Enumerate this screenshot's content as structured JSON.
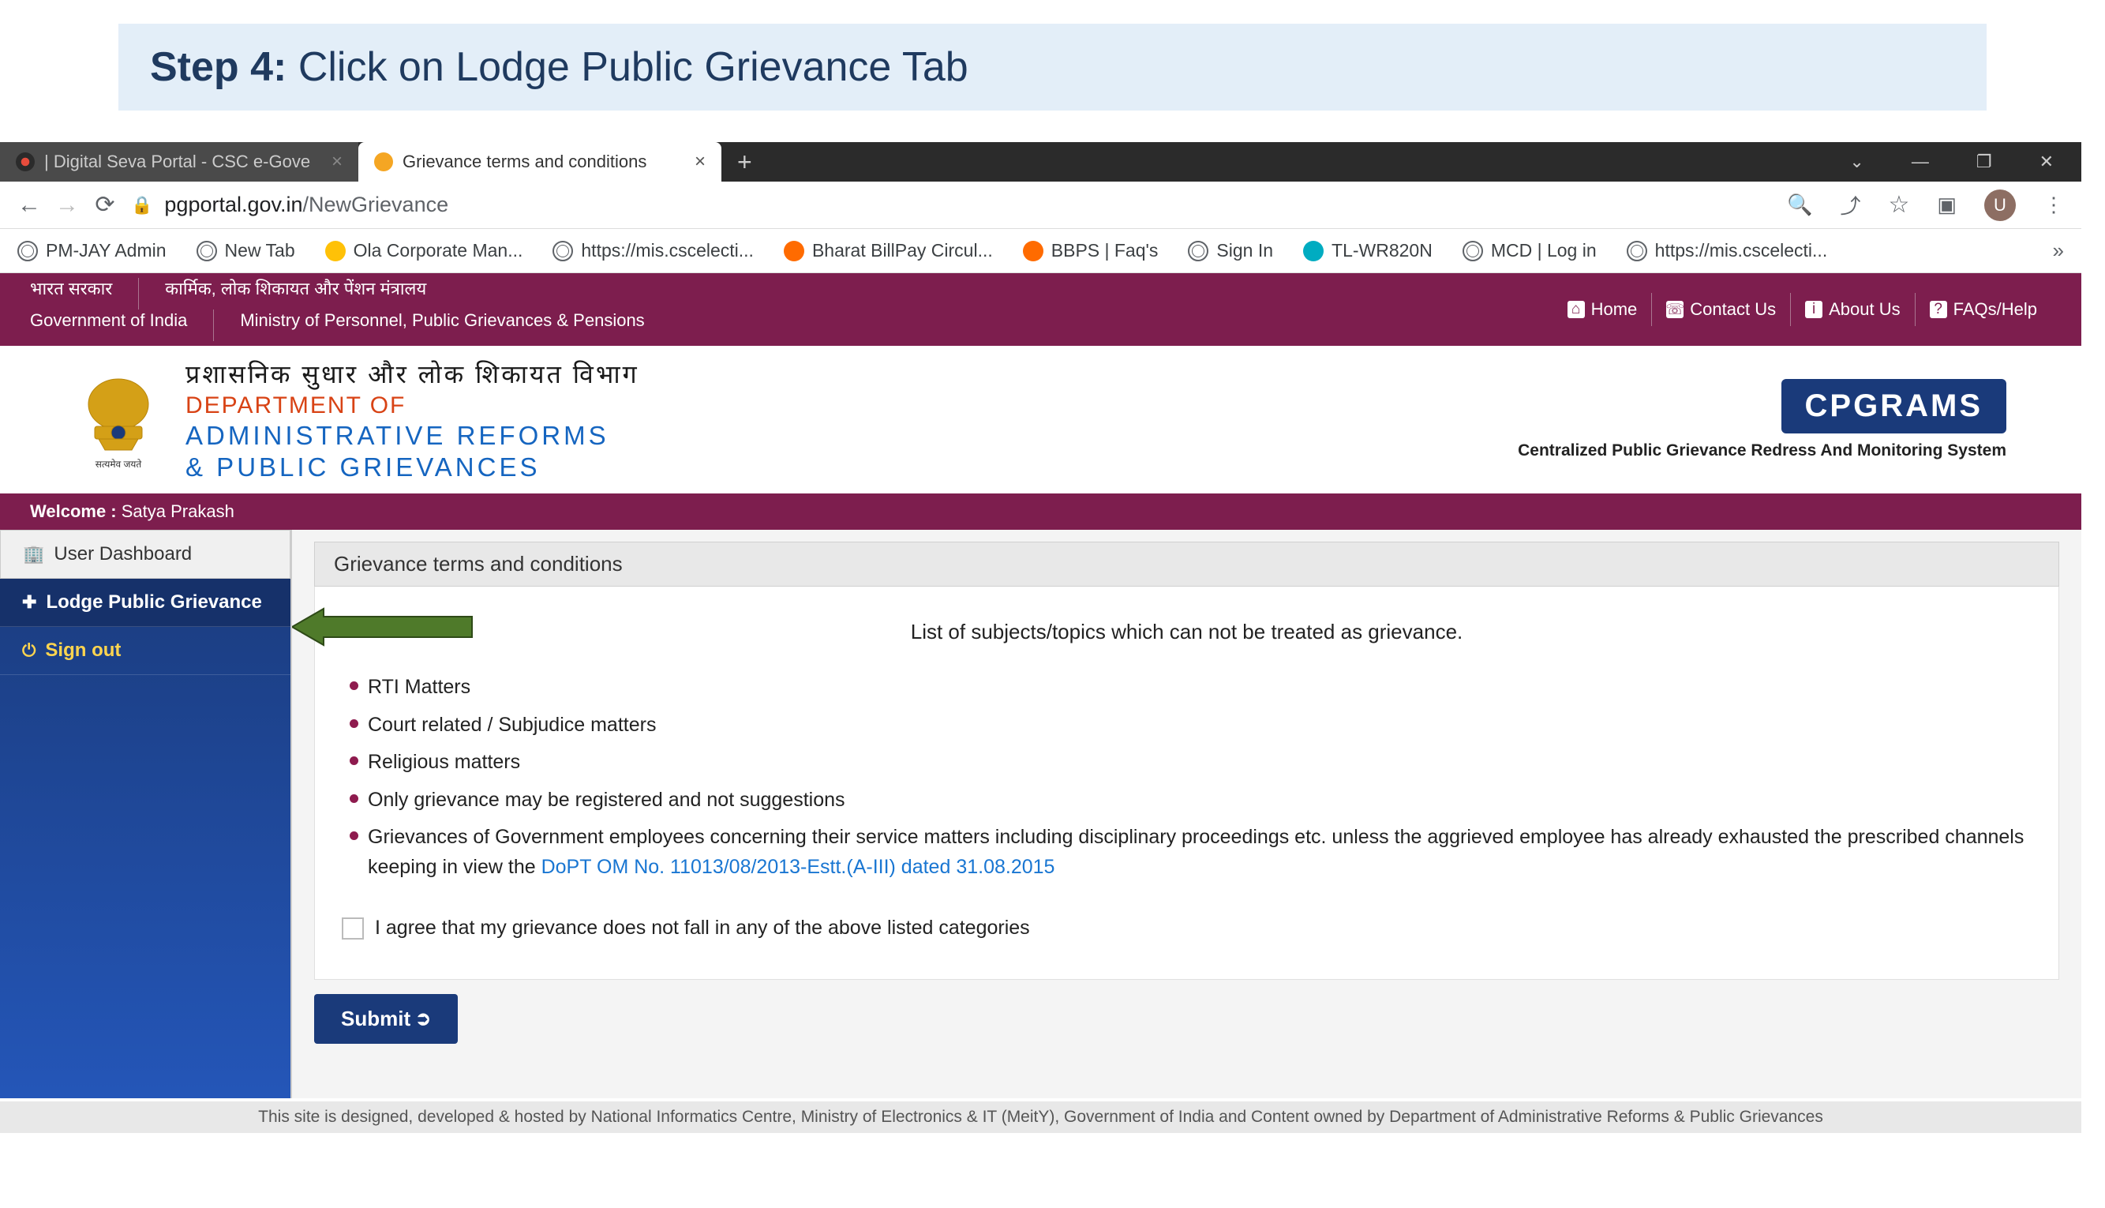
{
  "stepBanner": {
    "prefix": "Step 4:",
    "text": " Click on Lodge Public Grievance Tab"
  },
  "tabs": {
    "inactive": {
      "title": "| Digital Seva Portal - CSC e-Gove"
    },
    "active": {
      "title": "Grievance terms and conditions"
    }
  },
  "url": {
    "domain": "pgportal.gov.in",
    "path": "/NewGrievance"
  },
  "profileInitial": "U",
  "bookmarks": [
    {
      "label": "PM-JAY Admin",
      "icon": "globe"
    },
    {
      "label": "New Tab",
      "icon": "globe"
    },
    {
      "label": "Ola Corporate Man...",
      "icon": "yellow"
    },
    {
      "label": "https://mis.cscelecti...",
      "icon": "globe"
    },
    {
      "label": "Bharat BillPay Circul...",
      "icon": "orange"
    },
    {
      "label": "BBPS | Faq's",
      "icon": "orange-b"
    },
    {
      "label": "Sign In",
      "icon": "globe"
    },
    {
      "label": "TL-WR820N",
      "icon": "teal"
    },
    {
      "label": "MCD | Log in",
      "icon": "globe"
    },
    {
      "label": "https://mis.cscelecti...",
      "icon": "globe"
    }
  ],
  "govTop": {
    "leftHindi1": "भारत सरकार",
    "leftHindi2": "कार्मिक, लोक शिकायत और पेंशन मंत्रालय",
    "leftEng1": "Government of India",
    "leftEng2": "Ministry of Personnel, Public Grievances & Pensions",
    "links": [
      "Home",
      "Contact Us",
      "About Us",
      "FAQs/Help"
    ]
  },
  "dept": {
    "hindi": "प्रशासनिक सुधार और लोक शिकायत विभाग",
    "line1": "DEPARTMENT OF",
    "line2": "ADMINISTRATIVE REFORMS",
    "line3": "& PUBLIC GRIEVANCES",
    "cpgramsBadge": "CPGRAMS",
    "cpgramsSub": "Centralized Public Grievance Redress And Monitoring System"
  },
  "welcome": {
    "label": "Welcome : ",
    "name": "Satya Prakash"
  },
  "sidebar": {
    "dashboard": "User Dashboard",
    "lodge": "Lodge Public Grievance",
    "signout": "Sign out"
  },
  "panel": {
    "title": "Grievance terms and conditions",
    "subheading": "List of subjects/topics which can not be treated as grievance.",
    "items": [
      "RTI Matters",
      "Court related / Subjudice matters",
      "Religious matters",
      "Only grievance may be registered and not suggestions"
    ],
    "item5Prefix": "Grievances of Government employees concerning their service matters including disciplinary proceedings etc. unless the aggrieved employee has already exhausted the prescribed channels keeping in view the ",
    "item5Link": "DoPT OM No. 11013/08/2013-Estt.(A-III) dated 31.08.2015",
    "agree": "I agree that my grievance does not fall in any of the above listed categories",
    "submit": "Submit"
  },
  "footer": "This site is designed, developed & hosted by National Informatics Centre, Ministry of Electronics & IT (MeitY), Government of India and Content owned by Department of Administrative Reforms & Public Grievances"
}
